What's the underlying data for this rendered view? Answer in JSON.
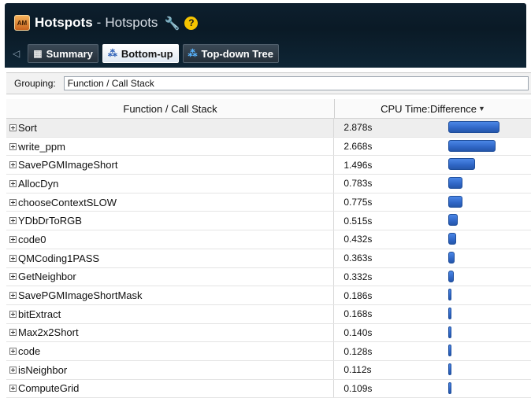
{
  "app": {
    "icon_text": "AM",
    "title_main": "Hotspots",
    "title_separator": "-",
    "title_sub": "Hotspots",
    "wrench_icon": "wrench-icon",
    "help_text": "?"
  },
  "tabs": [
    {
      "label": "Summary",
      "icon": "summary-icon",
      "active": false
    },
    {
      "label": "Bottom-up",
      "icon": "bottom-up-icon",
      "active": true
    },
    {
      "label": "Top-down Tree",
      "icon": "top-down-icon",
      "active": false
    }
  ],
  "grouping": {
    "label": "Grouping:",
    "value": "Function / Call Stack"
  },
  "table": {
    "headers": {
      "function": "Function / Call Stack",
      "cpu": "CPU Time:Difference"
    },
    "max_seconds": 2.878,
    "rows": [
      {
        "name": "Sort",
        "time": "2.878s",
        "seconds": 2.878
      },
      {
        "name": "write_ppm",
        "time": "2.668s",
        "seconds": 2.668
      },
      {
        "name": "SavePGMImageShort",
        "time": "1.496s",
        "seconds": 1.496
      },
      {
        "name": "AllocDyn",
        "time": "0.783s",
        "seconds": 0.783
      },
      {
        "name": "chooseContextSLOW",
        "time": "0.775s",
        "seconds": 0.775
      },
      {
        "name": "YDbDrToRGB",
        "time": "0.515s",
        "seconds": 0.515
      },
      {
        "name": "code0",
        "time": "0.432s",
        "seconds": 0.432
      },
      {
        "name": "QMCoding1PASS",
        "time": "0.363s",
        "seconds": 0.363
      },
      {
        "name": "GetNeighbor",
        "time": "0.332s",
        "seconds": 0.332
      },
      {
        "name": "SavePGMImageShortMask",
        "time": "0.186s",
        "seconds": 0.186
      },
      {
        "name": "bitExtract",
        "time": "0.168s",
        "seconds": 0.168
      },
      {
        "name": "Max2x2Short",
        "time": "0.140s",
        "seconds": 0.14
      },
      {
        "name": "code",
        "time": "0.128s",
        "seconds": 0.128
      },
      {
        "name": "isNeighbor",
        "time": "0.112s",
        "seconds": 0.112
      },
      {
        "name": "ComputeGrid",
        "time": "0.109s",
        "seconds": 0.109
      }
    ]
  },
  "colors": {
    "header_bg": "#0d1f2e",
    "bar_blue": "#2f66c6",
    "help_yellow": "#f5c400"
  }
}
